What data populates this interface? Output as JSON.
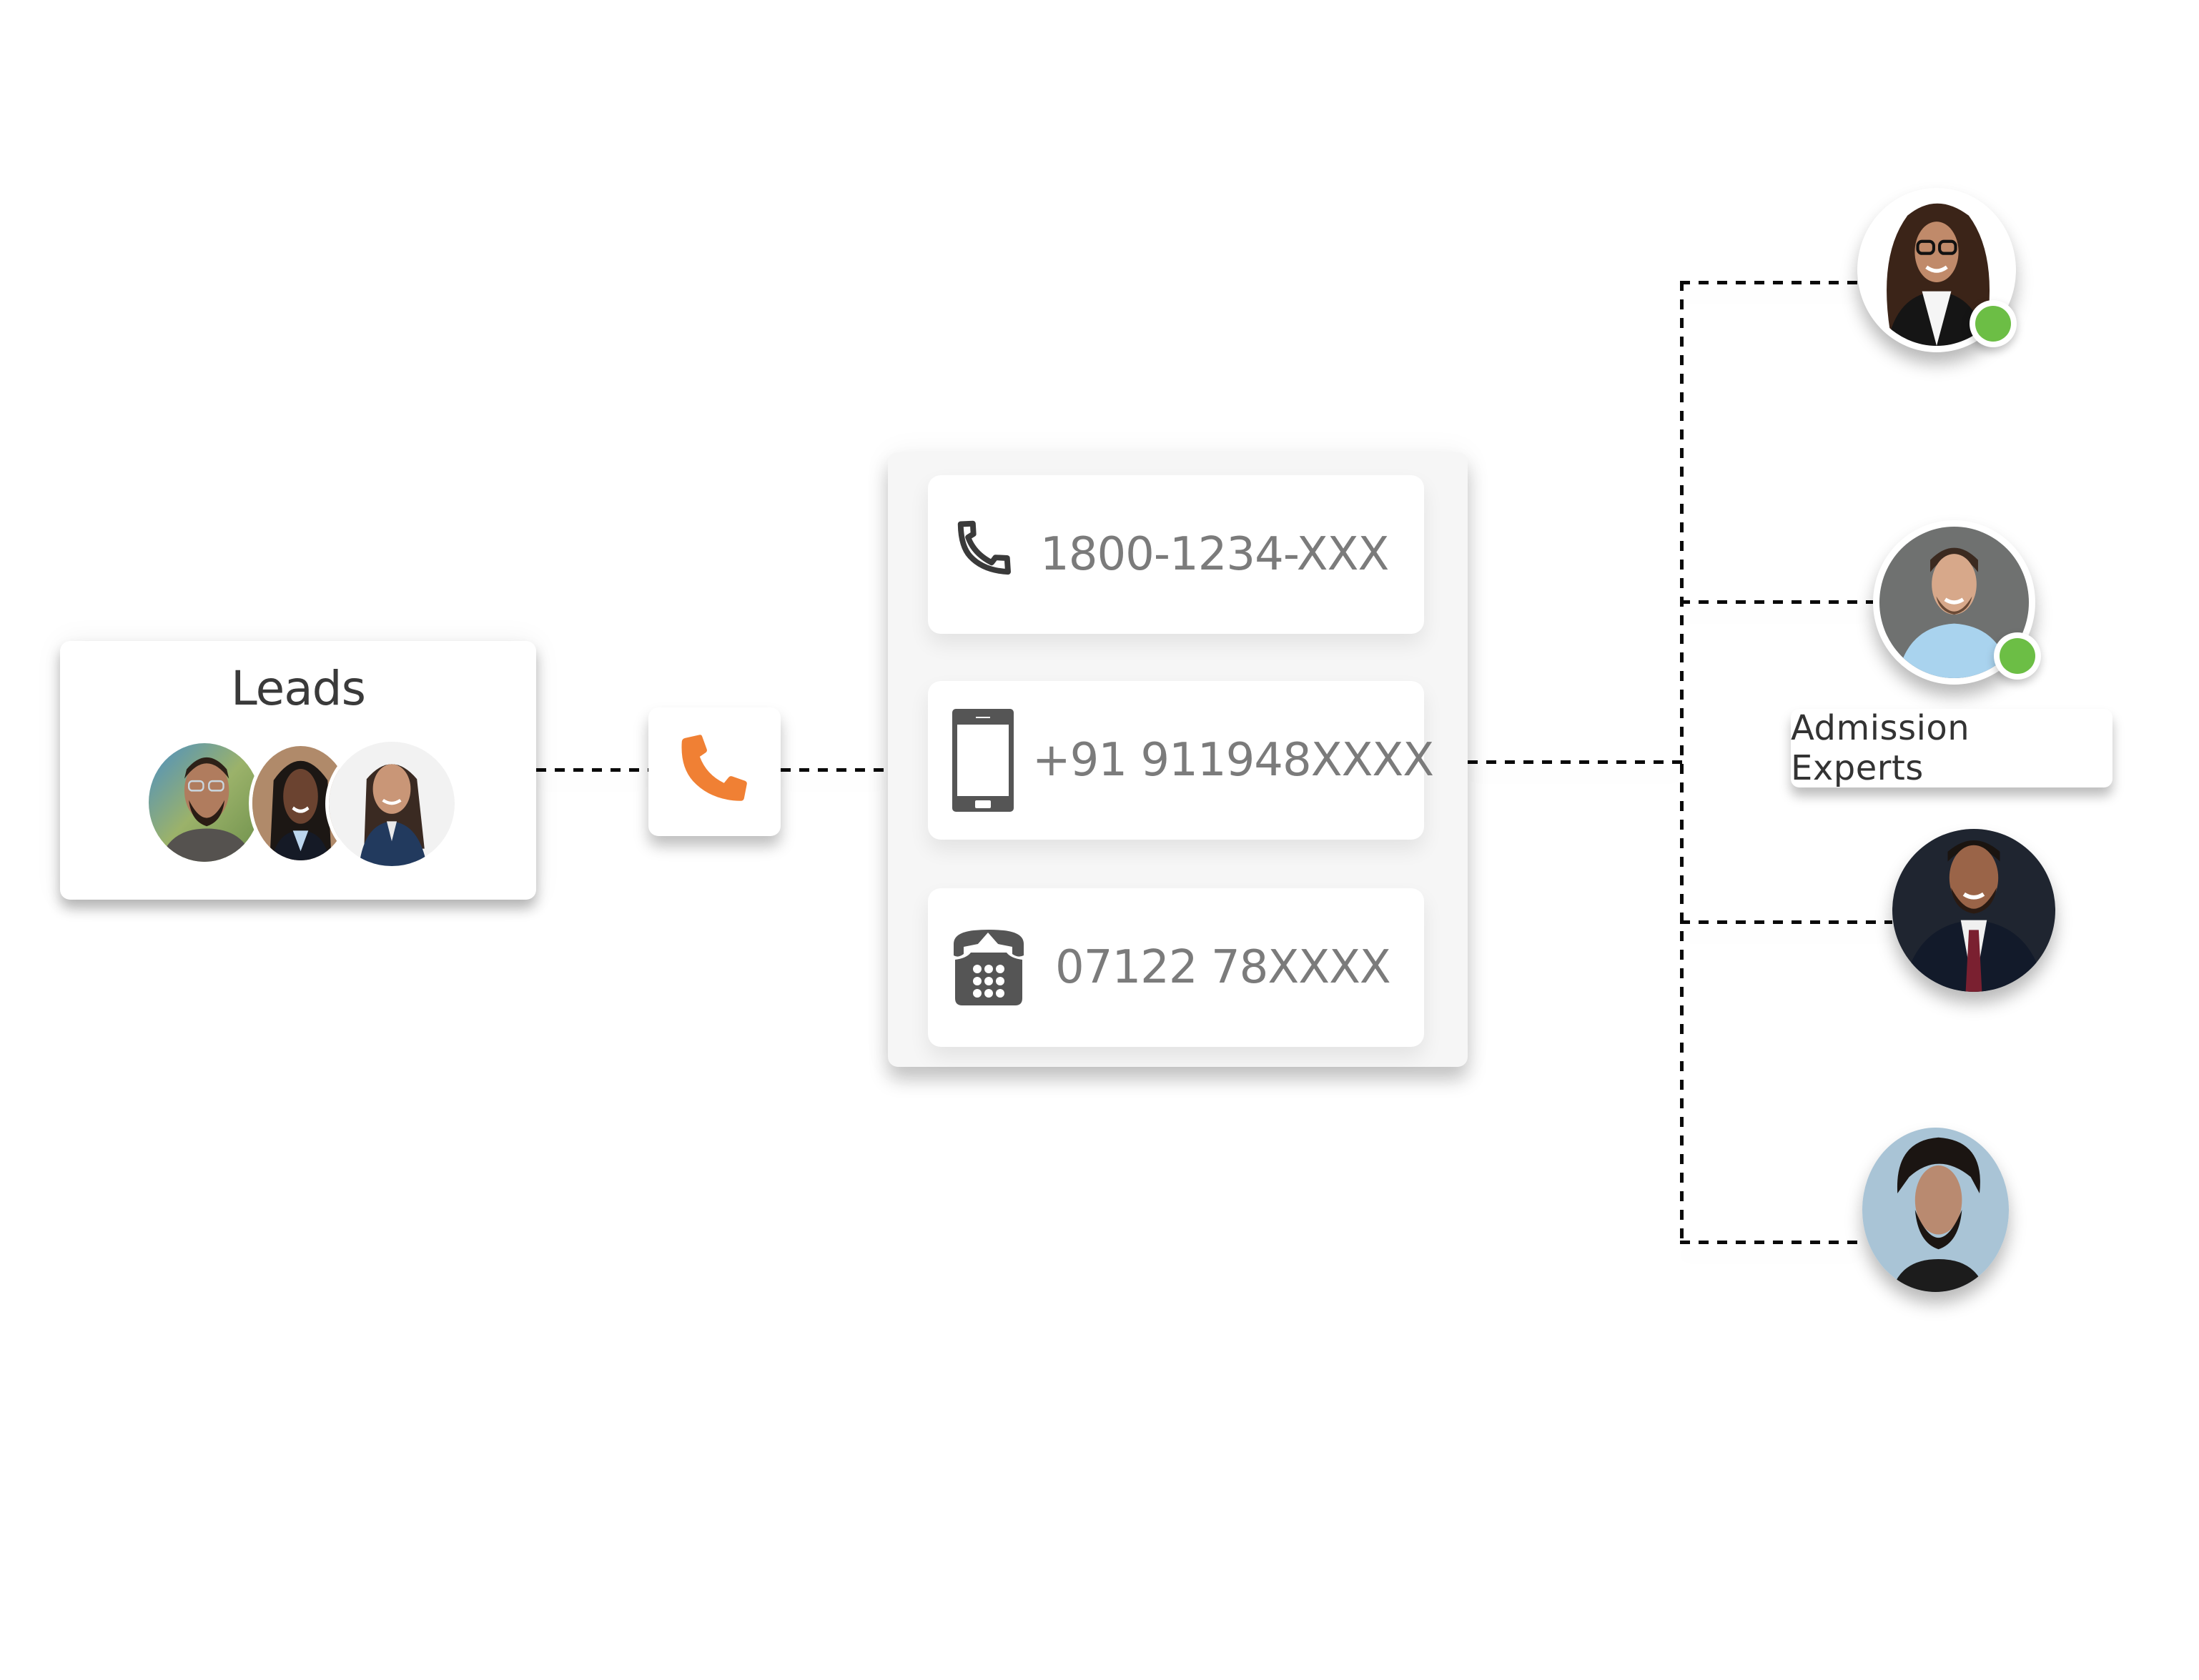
{
  "leads": {
    "title": "Leads",
    "avatars": [
      {
        "name": "lead-1",
        "desc": "bearded man with glasses"
      },
      {
        "name": "lead-2",
        "desc": "smiling woman"
      },
      {
        "name": "lead-3",
        "desc": "woman in navy blazer"
      }
    ]
  },
  "call_button": {
    "icon": "phone-icon",
    "color": "#F08034"
  },
  "numbers": [
    {
      "icon": "phone-handset-icon",
      "value": "1800-1234-XXX"
    },
    {
      "icon": "mobile-phone-icon",
      "value": "+91 911948XXXX"
    },
    {
      "icon": "desk-phone-icon",
      "value": "07122 78XXXX"
    }
  ],
  "experts": {
    "label": "Admission Experts",
    "members": [
      {
        "name": "expert-1",
        "desc": "woman with curly hair and glasses",
        "online": true
      },
      {
        "name": "expert-2",
        "desc": "man in light blue shirt",
        "online": true
      },
      {
        "name": "expert-3",
        "desc": "man in suit with red tie",
        "online": false
      },
      {
        "name": "expert-4",
        "desc": "man with beard",
        "online": false
      }
    ]
  },
  "colors": {
    "accent_orange": "#F08034",
    "status_online": "#6CBE45",
    "icon_gray": "#555555",
    "number_text": "#7B7B7B",
    "title_text": "#3A3A3A"
  }
}
